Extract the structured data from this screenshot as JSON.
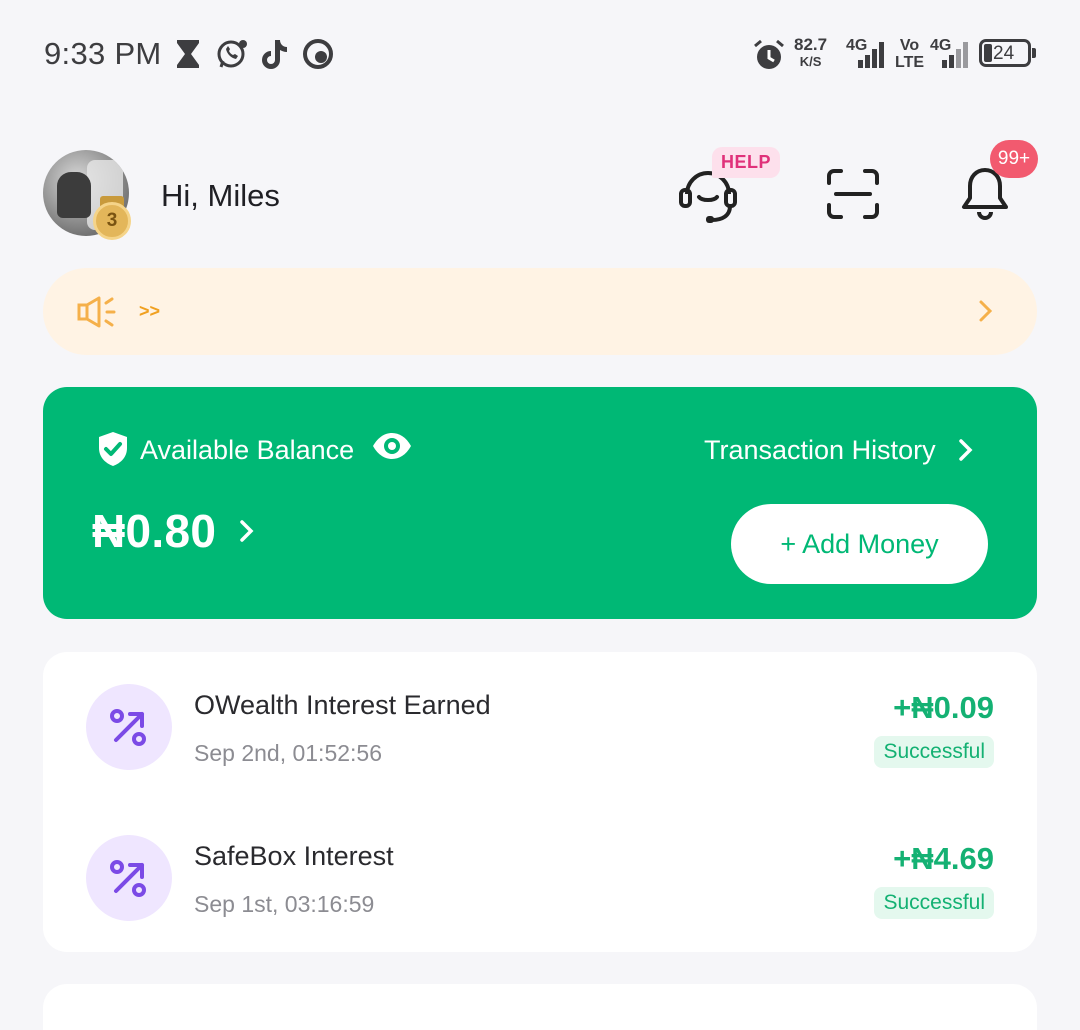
{
  "status_bar": {
    "time": "9:33 PM",
    "net_speed_value": "82.7",
    "net_speed_unit": "K/S",
    "sim1_label": "4G",
    "volte_top": "Vo",
    "volte_bottom": "LTE",
    "sim2_label": "4G",
    "battery_level": "24",
    "icons": [
      "hourglass-icon",
      "whatsapp-icon",
      "tiktok-icon",
      "app-icon",
      "alarm-icon"
    ]
  },
  "header": {
    "greeting": "Hi, Miles",
    "avatar_level": "3",
    "help_badge": "HELP",
    "notification_count": "99+",
    "icons": [
      "support-headset-icon",
      "scan-icon",
      "bell-icon"
    ]
  },
  "announcement": {
    "text": ">>",
    "icons": [
      "megaphone-icon",
      "chevron-right-icon"
    ]
  },
  "balance_card": {
    "label": "Available Balance",
    "amount": "₦0.80",
    "transaction_history_label": "Transaction History",
    "add_money_label": "+ Add Money",
    "colors": {
      "card_bg": "#00b875",
      "text": "#ffffff"
    }
  },
  "transactions": [
    {
      "title": "OWealth Interest Earned",
      "date": "Sep 2nd, 01:52:56",
      "amount": "+₦0.09",
      "status": "Successful",
      "icon": "percent-up-icon"
    },
    {
      "title": "SafeBox Interest",
      "date": "Sep 1st, 03:16:59",
      "amount": "+₦4.69",
      "status": "Successful",
      "icon": "percent-up-icon"
    }
  ],
  "colors": {
    "accent_green": "#00b875",
    "amount_green": "#14b173",
    "help_pink": "#e0317a",
    "badge_red": "#f25a6f",
    "announce_bg": "#fff3e4",
    "announce_accent": "#f0a020",
    "tx_icon_bg": "#efe6ff",
    "tx_icon_fg": "#7b4ae6"
  }
}
